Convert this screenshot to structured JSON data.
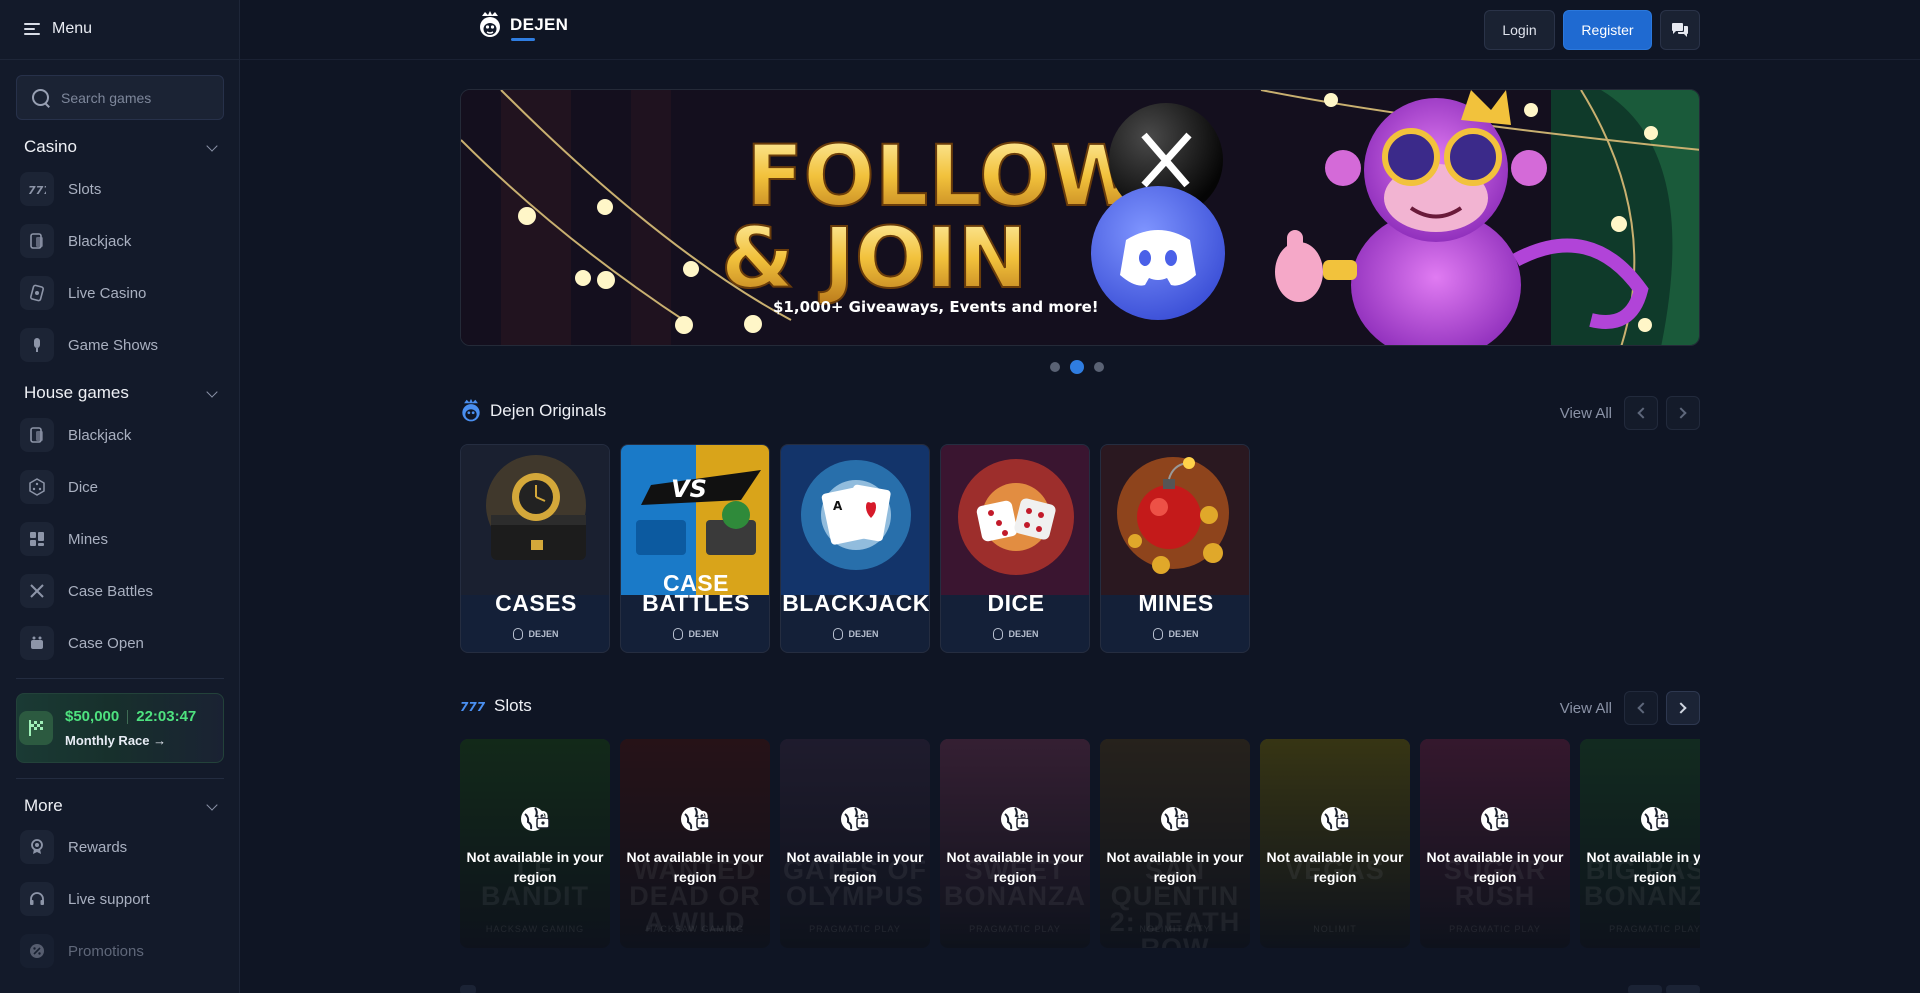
{
  "sidebar": {
    "menu_label": "Menu",
    "search_placeholder": "Search games",
    "casino": {
      "title": "Casino",
      "items": [
        {
          "label": "Slots",
          "icon": "slots-icon"
        },
        {
          "label": "Blackjack",
          "icon": "cards-icon"
        },
        {
          "label": "Live Casino",
          "icon": "live-cards-icon"
        },
        {
          "label": "Game Shows",
          "icon": "microphone-icon"
        }
      ]
    },
    "house_games": {
      "title": "House games",
      "items": [
        {
          "label": "Blackjack",
          "icon": "cards-icon"
        },
        {
          "label": "Dice",
          "icon": "dice-icon"
        },
        {
          "label": "Mines",
          "icon": "grid-icon"
        },
        {
          "label": "Case Battles",
          "icon": "swords-icon"
        },
        {
          "label": "Case Open",
          "icon": "case-icon"
        }
      ]
    },
    "race": {
      "amount": "$50,000",
      "timer": "22:03:47",
      "label": "Monthly Race →"
    },
    "more": {
      "title": "More",
      "items": [
        {
          "label": "Rewards",
          "icon": "rewards-icon"
        },
        {
          "label": "Live support",
          "icon": "headset-icon"
        },
        {
          "label": "Promotions",
          "icon": "promotions-icon"
        }
      ]
    }
  },
  "header": {
    "logo_text": "DEJEN",
    "login_label": "Login",
    "register_label": "Register",
    "chat_icon": "chat-icon"
  },
  "banner": {
    "line1": "FOLLOW",
    "line2": "& JOIN",
    "tagline": "$1,000+ Giveaways, Events and more!",
    "slides_total": 3,
    "active_slide": 2
  },
  "originals": {
    "title": "Dejen Originals",
    "view_all": "View All",
    "cards": [
      {
        "name": "CASES",
        "brand": "DEJEN"
      },
      {
        "name": "CASE BATTLES",
        "brand": "DEJEN"
      },
      {
        "name": "BLACKJACK",
        "brand": "DEJEN"
      },
      {
        "name": "DICE",
        "brand": "DEJEN"
      },
      {
        "name": "MINES",
        "brand": "DEJEN"
      }
    ]
  },
  "slots": {
    "title": "Slots",
    "view_all": "View All",
    "unavailable_text": "Not available in your region",
    "cards": [
      {
        "bg_title": "LE BANDIT",
        "bg_provider": "HACKSAW GAMING",
        "color": "#1e4a1c"
      },
      {
        "bg_title": "WANTED DEAD OR A WILD",
        "bg_provider": "HACKSAW GAMING",
        "color": "#4a1818"
      },
      {
        "bg_title": "GATES OF OLYMPUS",
        "bg_provider": "PRAGMATIC PLAY",
        "color": "#3a2c48"
      },
      {
        "bg_title": "SWEET BONANZA",
        "bg_provider": "PRAGMATIC PLAY",
        "color": "#6a3454"
      },
      {
        "bg_title": "SAN QUENTIN 2: DEATH ROW",
        "bg_provider": "NOLIMIT CITY",
        "color": "#4a3a22"
      },
      {
        "bg_title": "VEGAS",
        "bg_provider": "NOLIMIT",
        "color": "#6e6410"
      },
      {
        "bg_title": "SUGAR RUSH",
        "bg_provider": "PRAGMATIC PLAY",
        "color": "#6a2448"
      },
      {
        "bg_title": "BIG BASS BONANZA",
        "bg_provider": "PRAGMATIC PLAY",
        "color": "#1e4e2a"
      }
    ]
  },
  "colors": {
    "accent": "#1f6ad1",
    "race_green": "#4ee27f",
    "background": "#0f1524"
  }
}
